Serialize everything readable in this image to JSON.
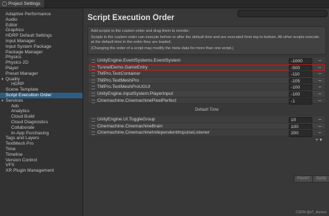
{
  "window": {
    "tab_title": "Project Settings",
    "tab_icon": "gear-icon"
  },
  "sidebar": {
    "items": [
      {
        "label": "Adaptive Performance",
        "level": 0
      },
      {
        "label": "Audio",
        "level": 0
      },
      {
        "label": "Editor",
        "level": 0
      },
      {
        "label": "Graphics",
        "level": 0
      },
      {
        "label": "HDRP Default Settings",
        "level": 0
      },
      {
        "label": "Input Manager",
        "level": 0
      },
      {
        "label": "Input System Package",
        "level": 0
      },
      {
        "label": "Package Manager",
        "level": 0
      },
      {
        "label": "Physics",
        "level": 0
      },
      {
        "label": "Physics 2D",
        "level": 0
      },
      {
        "label": "Player",
        "level": 0
      },
      {
        "label": "Preset Manager",
        "level": 0
      },
      {
        "label": "Quality",
        "level": 0,
        "expanded": true
      },
      {
        "label": "HDRP",
        "level": 1
      },
      {
        "label": "Scene Template",
        "level": 0
      },
      {
        "label": "Script Execution Order",
        "level": 0,
        "selected": true
      },
      {
        "label": "Services",
        "level": 0,
        "expanded": true
      },
      {
        "label": "Ads",
        "level": 1
      },
      {
        "label": "Analytics",
        "level": 1
      },
      {
        "label": "Cloud Build",
        "level": 1
      },
      {
        "label": "Cloud Diagnostics",
        "level": 1
      },
      {
        "label": "Collaborate",
        "level": 1
      },
      {
        "label": "In-App Purchasing",
        "level": 1
      },
      {
        "label": "Tags and Layers",
        "level": 0
      },
      {
        "label": "TextMesh Pro",
        "level": 0
      },
      {
        "label": "Time",
        "level": 0
      },
      {
        "label": "Timeline",
        "level": 0
      },
      {
        "label": "Version Control",
        "level": 0
      },
      {
        "label": "VFX",
        "level": 0
      },
      {
        "label": "XR Plugin Management",
        "level": 0
      }
    ]
  },
  "main": {
    "title": "Script Execution Order",
    "help": [
      "Add scripts to the custom order and drag them to reorder.",
      "Scripts in the custom order can execute before or after the default time and are executed from top to bottom. All other scripts execute at the default time in the order they are loaded.",
      "(Changing the order of a script may modify the meta data for more than one script.)"
    ],
    "before_default": [
      {
        "name": "UnityEngine.EventSystems.EventSystem",
        "value": "-1000"
      },
      {
        "name": "TunnelDemo.GameEntry",
        "value": "-500",
        "highlighted": true
      },
      {
        "name": "TMPro.TextContainer",
        "value": "-110"
      },
      {
        "name": "TMPro.TextMeshPro",
        "value": "-105"
      },
      {
        "name": "TMPro.TextMeshProUGUI",
        "value": "-100"
      },
      {
        "name": "UnityEngine.InputSystem.PlayerInput",
        "value": "-100"
      },
      {
        "name": "Cinemachine.CinemachinePixelPerfect",
        "value": "-1"
      }
    ],
    "default_time_label": "Default Time",
    "after_default": [
      {
        "name": "UnityEngine.UI.ToggleGroup",
        "value": "10"
      },
      {
        "name": "Cinemachine.CinemachineBrain",
        "value": "100"
      },
      {
        "name": "Cinemachine.CinemachineIndependentImpulseListener",
        "value": "200"
      }
    ],
    "footer": {
      "add_remove": "+ ▾"
    },
    "revert_label": "Revert",
    "apply_label": "Apply"
  },
  "watermark": "CSDN @sT_Aurora"
}
